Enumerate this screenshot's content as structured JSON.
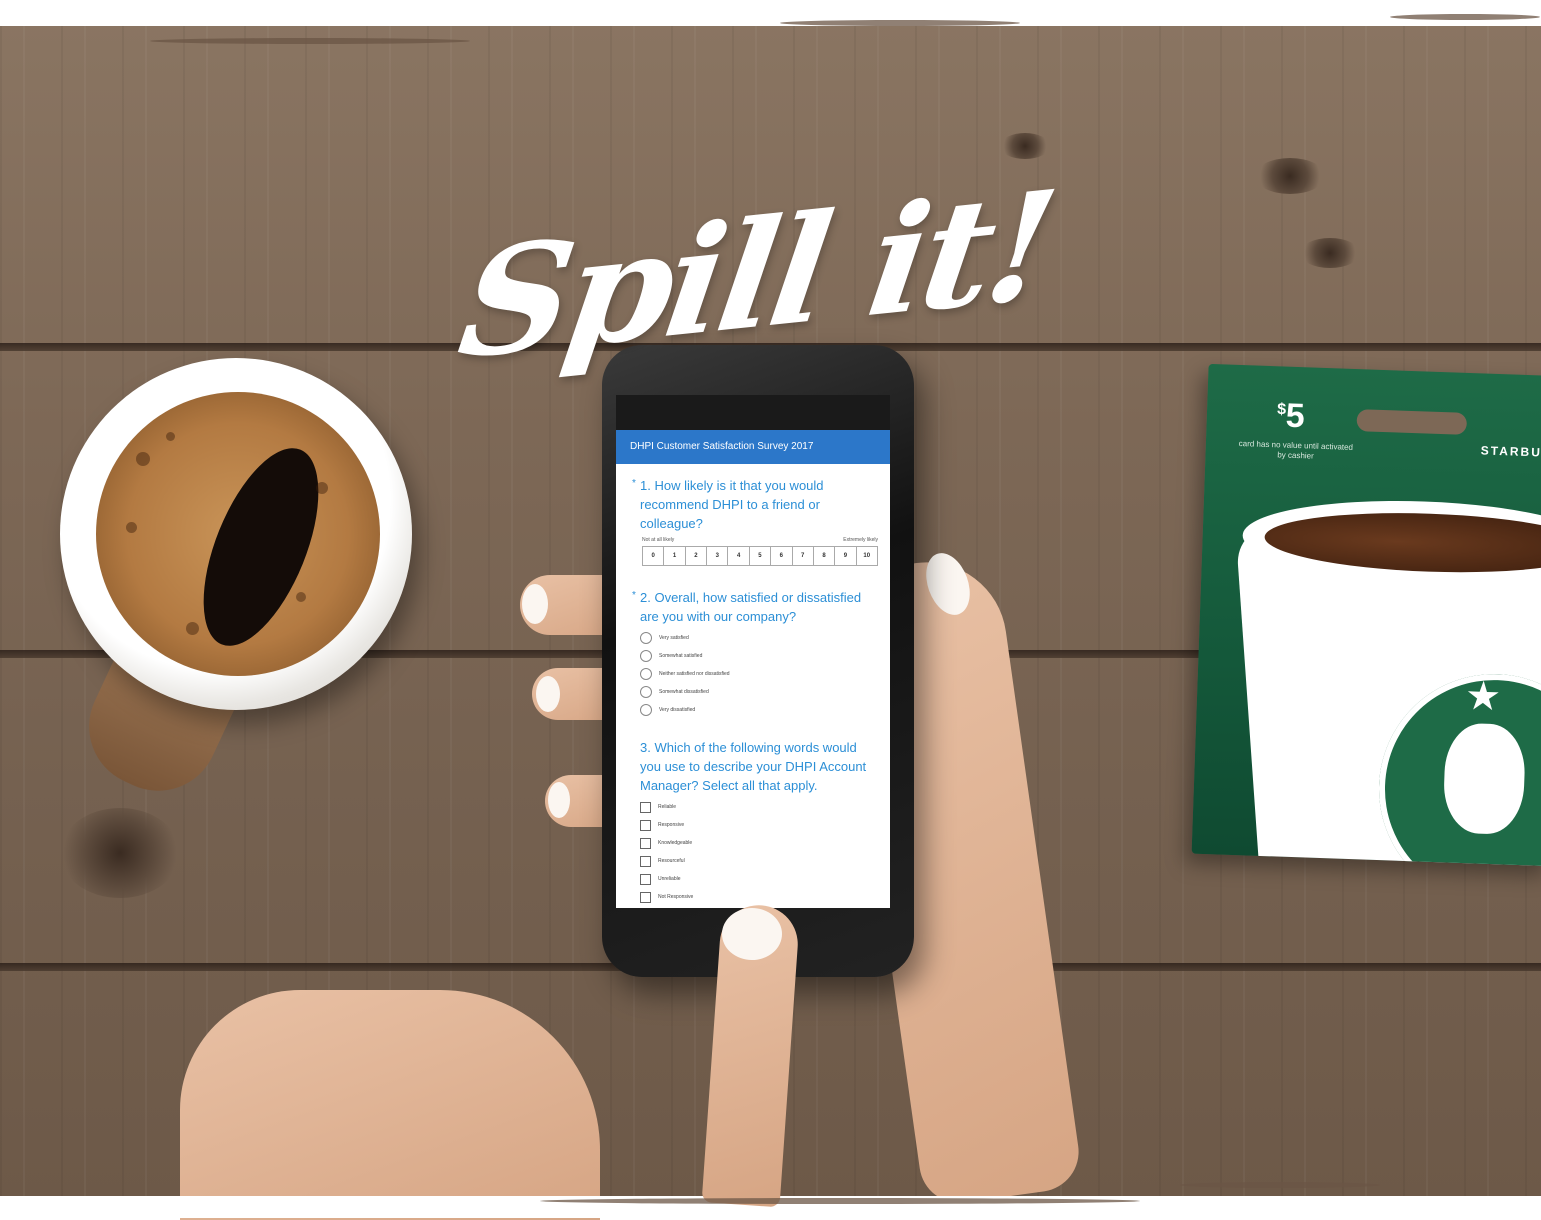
{
  "headline": "Spill it!",
  "survey": {
    "title": "DHPI Customer Satisfaction Survey 2017",
    "q1": {
      "text": "1. How likely is it that you would recommend DHPI to a friend or colleague?",
      "low_label": "Not at all likely",
      "high_label": "Extremely likely",
      "scale": [
        "0",
        "1",
        "2",
        "3",
        "4",
        "5",
        "6",
        "7",
        "8",
        "9",
        "10"
      ]
    },
    "q2": {
      "text": "2. Overall, how satisfied or dissatisfied are you with our company?",
      "options": [
        "Very satisfied",
        "Somewhat satisfied",
        "Neither satisfied nor dissatisfied",
        "Somewhat dissatisfied",
        "Very dissatisfied"
      ]
    },
    "q3": {
      "text": "3. Which of the following words would you use to describe your DHPI Account Manager? Select all that apply.",
      "options": [
        "Reliable",
        "Responsive",
        "Knowledgeable",
        "Resourceful",
        "Unreliable",
        "Not Responsive"
      ]
    },
    "required_marker": "*"
  },
  "gift_card": {
    "currency": "$",
    "amount": "5",
    "fine_print": "card has no value until activated by cashier",
    "brand": "STARBUCKS"
  },
  "colors": {
    "survey_header": "#2c77c9",
    "question_text": "#2c8fd6",
    "card_green": "#1e6b47",
    "wood": "#7d6856"
  }
}
